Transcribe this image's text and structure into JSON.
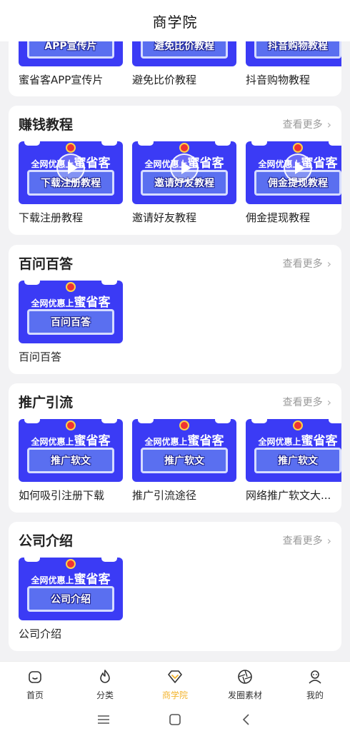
{
  "header": {
    "title": "商学院"
  },
  "more_label": "查看更多",
  "colors": {
    "accent": "#f3b32b",
    "thumb_blue": "#3b3bf5"
  },
  "partial_top": {
    "items": [
      {
        "caption": "蜜省客APP宣传片",
        "plate": "APP宣传片"
      },
      {
        "caption": "避免比价教程",
        "plate": "避免比价教程"
      },
      {
        "caption": "抖音购物教程",
        "plate": "抖音购物教程"
      }
    ]
  },
  "sections": [
    {
      "title": "赚钱教程",
      "items": [
        {
          "caption": "下载注册教程",
          "top_small": "全网优惠上",
          "top_large": "蜜省客",
          "plate": "下载注册教程",
          "video": true
        },
        {
          "caption": "邀请好友教程",
          "top_small": "全网优惠上",
          "top_large": "蜜省客",
          "plate": "邀请好友教程",
          "video": true
        },
        {
          "caption": "佣金提现教程",
          "top_small": "全网优惠上",
          "top_large": "蜜省客",
          "plate": "佣金提现教程",
          "video": true
        }
      ]
    },
    {
      "title": "百问百答",
      "items": [
        {
          "caption": "百问百答",
          "top_small": "全网优惠上",
          "top_large": "蜜省客",
          "plate": "百问百答",
          "video": false
        }
      ]
    },
    {
      "title": "推广引流",
      "items": [
        {
          "caption": "如何吸引注册下载",
          "top_small": "全网优惠上",
          "top_large": "蜜省客",
          "plate": "推广软文",
          "video": false
        },
        {
          "caption": "推广引流途径",
          "top_small": "全网优惠上",
          "top_large": "蜜省客",
          "plate": "推广软文",
          "video": false
        },
        {
          "caption": "网络推广软文大...",
          "top_small": "全网优惠上",
          "top_large": "蜜省客",
          "plate": "推广软文",
          "video": false
        }
      ]
    },
    {
      "title": "公司介绍",
      "items": [
        {
          "caption": "公司介绍",
          "top_small": "全网优惠上",
          "top_large": "蜜省客",
          "plate": "公司介绍",
          "video": false
        }
      ]
    }
  ],
  "tabbar": [
    {
      "label": "首页",
      "icon": "home-icon"
    },
    {
      "label": "分类",
      "icon": "flame-icon"
    },
    {
      "label": "商学院",
      "icon": "diamond-icon",
      "active": true
    },
    {
      "label": "发圈素材",
      "icon": "aperture-icon"
    },
    {
      "label": "我的",
      "icon": "profile-icon"
    }
  ]
}
